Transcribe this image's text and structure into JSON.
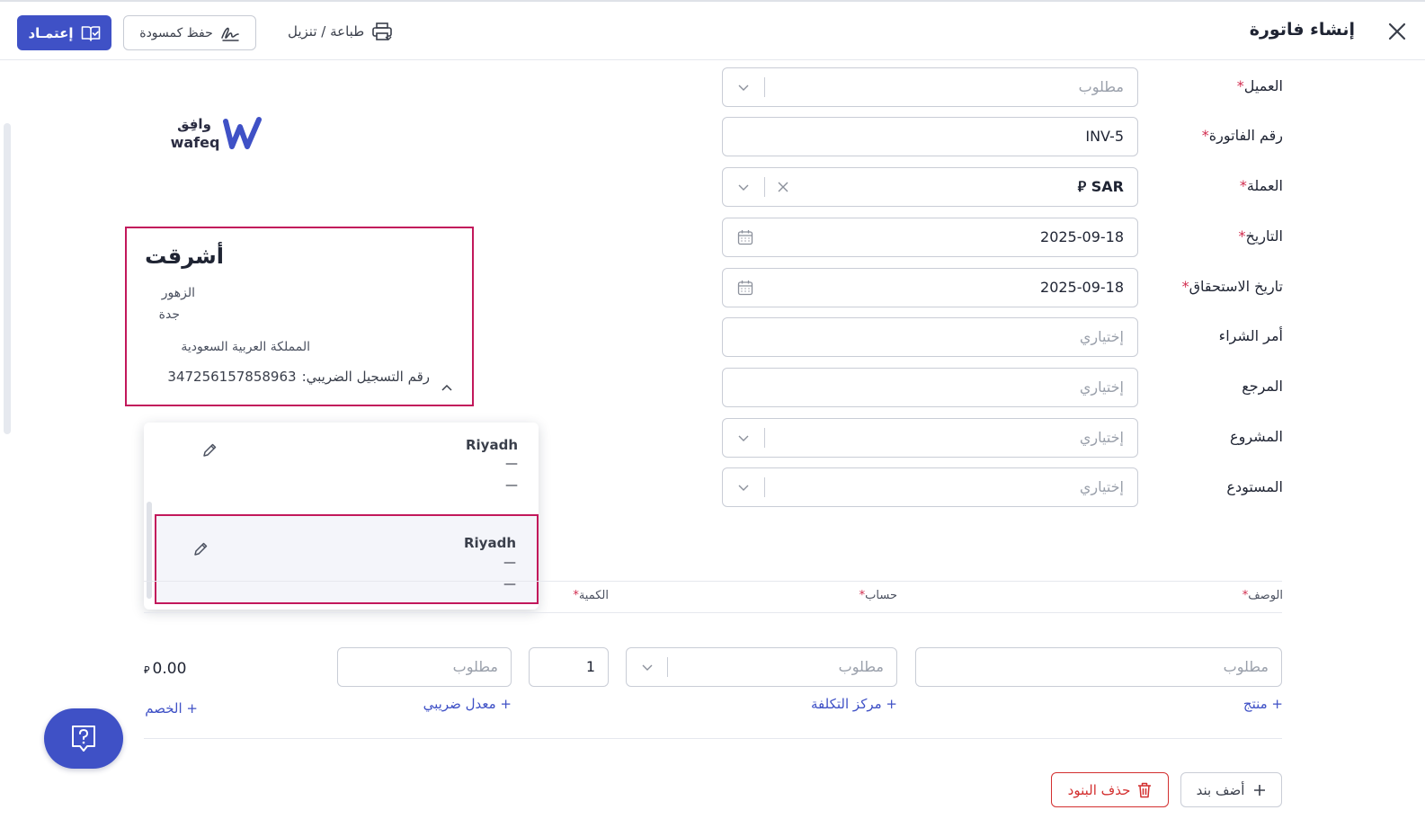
{
  "header": {
    "title": "إنشاء فاتورة",
    "approve_label": "إعتمـاد",
    "draft_label": "حفظ كمسودة",
    "print_label": "طباعة / تنزيل",
    "accent_color": "#3f51c6",
    "icons": [
      "close-icon",
      "book-check-icon",
      "signature-icon",
      "printer-icon"
    ]
  },
  "form": {
    "customer": {
      "label": "العميل",
      "required": "*",
      "placeholder": "مطلوب"
    },
    "invoice_number": {
      "label": "رقم الفاتورة",
      "required": "*",
      "value": "INV-5"
    },
    "currency": {
      "label": "العملة",
      "required": "*",
      "value": "SAR",
      "symbol": "⃁"
    },
    "date": {
      "label": "التاريخ",
      "required": "*",
      "value": "2025-09-18"
    },
    "due_date": {
      "label": "تاريخ الاستحقاق",
      "required": "*",
      "value": "2025-09-18"
    },
    "purchase_order": {
      "label": "أمر الشراء",
      "placeholder": "إختياري"
    },
    "reference": {
      "label": "المرجع",
      "placeholder": "إختياري"
    },
    "project": {
      "label": "المشروع",
      "placeholder": "إختياري"
    },
    "warehouse": {
      "label": "المستودع",
      "placeholder": "إختياري"
    }
  },
  "logo": {
    "arabic": "وافِق",
    "latin": "wafeq",
    "mark": "W"
  },
  "customer_card": {
    "name": "أشرقت",
    "district": "الزهور",
    "city": "جدة",
    "country": "المملكة العربية السعودية",
    "vat_label": "رقم التسجيل الضريبي:",
    "vat_number": "347256157858963",
    "highlight_color": "#c2185b"
  },
  "address_dropdown": {
    "options": [
      {
        "name": "Riyadh",
        "line1": "—",
        "line2": "—",
        "selected": false
      },
      {
        "name": "Riyadh",
        "line1": "—",
        "line2": "—",
        "selected": true
      }
    ]
  },
  "items": {
    "headers": {
      "description": "الوصف",
      "account": "حساب",
      "quantity": "الكمية",
      "required": "*"
    },
    "row": {
      "description_placeholder": "مطلوب",
      "account_placeholder": "مطلوب",
      "quantity": "1",
      "price_placeholder": "مطلوب",
      "total": "0.00",
      "currency_symbol": "⃁"
    },
    "links": {
      "product": "+ منتج",
      "cost_center": "+ مركز التكلفة",
      "tax_rate": "+ معدل ضريبي",
      "discount": "+ الخصم"
    }
  },
  "actions": {
    "add_line": "أضف بند",
    "delete_lines": "حذف البنود",
    "danger_color": "#d32f2f"
  }
}
